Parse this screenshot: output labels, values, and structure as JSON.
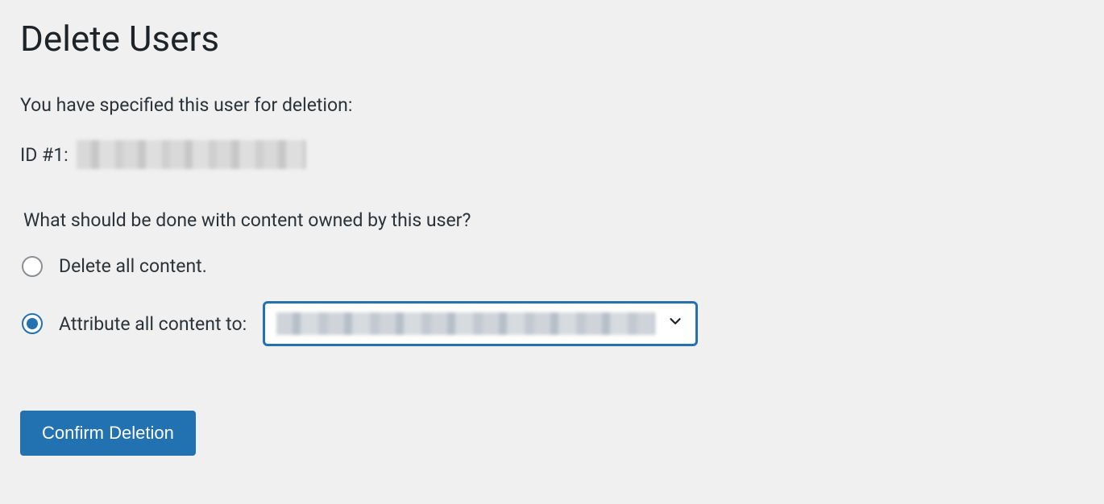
{
  "page": {
    "title": "Delete Users"
  },
  "intro_text": "You have specified this user for deletion:",
  "user_id_prefix": "ID #1:",
  "content_question": "What should be done with content owned by this user?",
  "options": {
    "delete_label": "Delete all content.",
    "attribute_label": "Attribute all content to:",
    "selected": "attribute"
  },
  "submit": {
    "label": "Confirm Deletion"
  }
}
